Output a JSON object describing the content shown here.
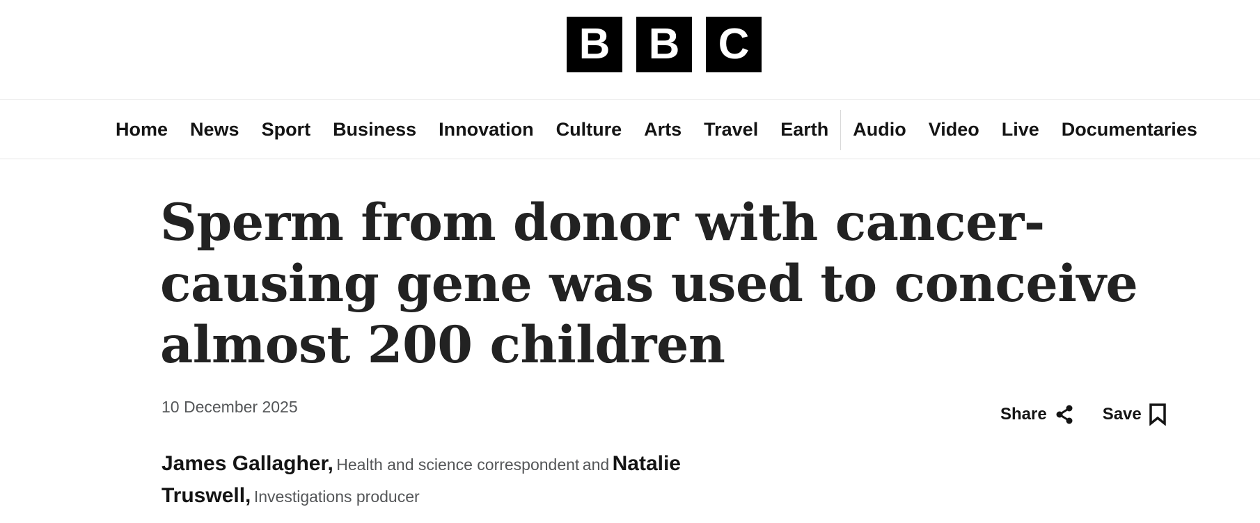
{
  "logo": {
    "letters": [
      "B",
      "B",
      "C"
    ]
  },
  "nav": {
    "primary": [
      "Home",
      "News",
      "Sport",
      "Business",
      "Innovation",
      "Culture",
      "Arts",
      "Travel",
      "Earth"
    ],
    "secondary": [
      "Audio",
      "Video",
      "Live",
      "Documentaries"
    ]
  },
  "article": {
    "headline": "Sperm from donor with cancer-causing gene was used to conceive almost 200 children",
    "date": "10 December 2025",
    "actions": {
      "share_label": "Share",
      "share_icon": "share-icon",
      "save_label": "Save",
      "save_icon": "bookmark-icon"
    },
    "byline": {
      "conjunction": "and",
      "authors": [
        {
          "name": "James Gallagher,",
          "role": "Health and science correspondent"
        },
        {
          "name": "Natalie Truswell,",
          "role": "Investigations producer"
        }
      ]
    }
  }
}
